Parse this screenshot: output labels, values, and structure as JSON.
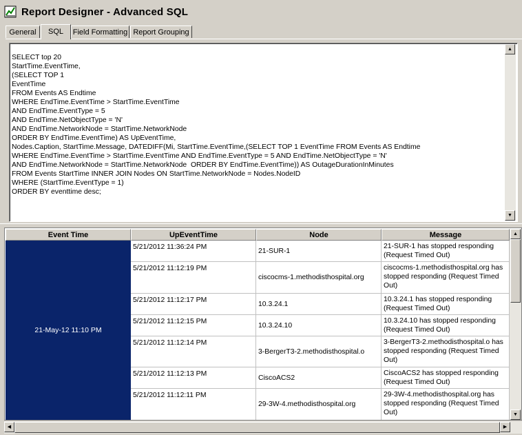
{
  "window": {
    "title": "Report Designer - Advanced SQL",
    "icon": "report-designer-icon"
  },
  "tabs": [
    {
      "label": "General"
    },
    {
      "label": "SQL"
    },
    {
      "label": "Field Formatting"
    },
    {
      "label": "Report Grouping"
    }
  ],
  "active_tab": "SQL",
  "sql": {
    "query": "SELECT top 20\nStartTime.EventTime,\n(SELECT TOP 1\nEventTime\nFROM Events AS Endtime\nWHERE EndTime.EventTime > StartTime.EventTime\nAND EndTime.EventType = 5\nAND EndTime.NetObjectType = 'N'\nAND EndTime.NetworkNode = StartTime.NetworkNode\nORDER BY EndTime.EventTime) AS UpEventTime,\nNodes.Caption, StartTime.Message, DATEDIFF(Mi, StartTime.EventTime,(SELECT TOP 1 EventTime FROM Events AS Endtime\nWHERE EndTime.EventTime > StartTime.EventTime AND EndTime.EventType = 5 AND EndTime.NetObjectType = 'N'\nAND EndTime.NetworkNode = StartTime.NetworkNode  ORDER BY EndTime.EventTime)) AS OutageDurationInMinutes\nFROM Events StartTime INNER JOIN Nodes ON StartTime.NetworkNode = Nodes.NodeID\nWHERE (StartTime.EventType = 1)\nORDER BY eventtime desc;"
  },
  "grid": {
    "columns": [
      "Event Time",
      "UpEventTime",
      "Node",
      "Message"
    ],
    "event_time": "21-May-12 11:10 PM",
    "rows": [
      {
        "up_event_time": "5/21/2012 11:36:24 PM",
        "node": "21-SUR-1",
        "message": "21-SUR-1 has stopped responding (Request Timed Out)"
      },
      {
        "up_event_time": "5/21/2012 11:12:19 PM",
        "node": "ciscocms-1.methodisthospital.org",
        "message": "ciscocms-1.methodisthospital.org has stopped responding (Request Timed Out)"
      },
      {
        "up_event_time": "5/21/2012 11:12:17 PM",
        "node": "10.3.24.1",
        "message": "10.3.24.1 has stopped responding (Request Timed Out)"
      },
      {
        "up_event_time": "5/21/2012 11:12:15 PM",
        "node": "10.3.24.10",
        "message": "10.3.24.10 has stopped responding (Request Timed Out)"
      },
      {
        "up_event_time": "5/21/2012 11:12:14 PM",
        "node": "3-BergerT3-2.methodisthospital.o",
        "message": "3-BergerT3-2.methodisthospital.o has stopped responding (Request Timed Out)"
      },
      {
        "up_event_time": "5/21/2012 11:12:13 PM",
        "node": "CiscoACS2",
        "message": "CiscoACS2 has stopped responding (Request Timed Out)"
      },
      {
        "up_event_time": "5/21/2012 11:12:11 PM",
        "node": "29-3W-4.methodisthospital.org",
        "message": "29-3W-4.methodisthospital.org has stopped responding (Request Timed Out)"
      }
    ]
  },
  "colors": {
    "chrome": "#d4d0c8",
    "selection": "#0a246a"
  }
}
